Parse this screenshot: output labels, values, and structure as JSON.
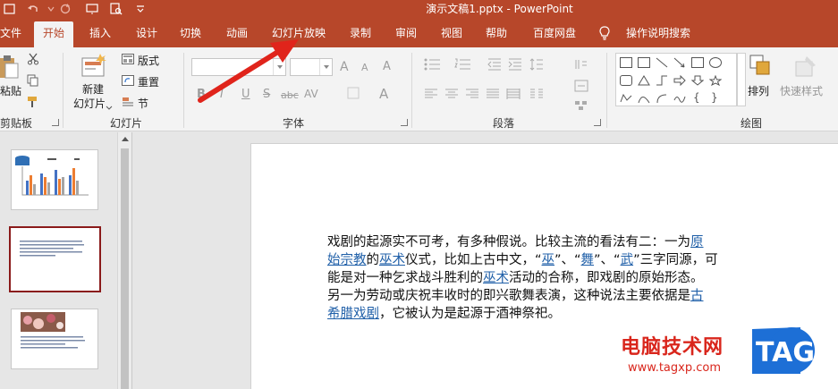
{
  "window": {
    "title": "演示文稿1.pptx  -  PowerPoint"
  },
  "tabs": [
    "文件",
    "开始",
    "插入",
    "设计",
    "切换",
    "动画",
    "幻灯片放映",
    "录制",
    "审阅",
    "视图",
    "帮助",
    "百度网盘"
  ],
  "active_tab": "开始",
  "tell_me": "操作说明搜索",
  "ribbon": {
    "clipboard": {
      "paste": "粘贴",
      "label": "剪贴板"
    },
    "slides": {
      "new_slide_1": "新建",
      "new_slide_2": "幻灯片",
      "layout": "版式",
      "reset": "重置",
      "section": "节",
      "label": "幻灯片"
    },
    "font": {
      "label": "字体",
      "bold": "B",
      "italic": "I",
      "underline": "U",
      "strike": "S",
      "abc": "abc",
      "grow": "A",
      "shrink": "A",
      "clear": "A",
      "color": "A",
      "spacing": "AV"
    },
    "paragraph": {
      "label": "段落"
    },
    "drawing": {
      "arrange": "排列",
      "quick_styles": "快速样式",
      "label": "绘图"
    }
  },
  "slide_text": {
    "lines": [
      [
        {
          "t": "戏剧的起源实不可考，有多种假说。比较主流的看法有二：一为"
        },
        {
          "t": "原",
          "link": true
        }
      ],
      [
        {
          "t": "始宗教",
          "link": true
        },
        {
          "t": "的"
        },
        {
          "t": "巫术",
          "link": true
        },
        {
          "t": "仪式，比如上古中文，“"
        },
        {
          "t": "巫",
          "link": true
        },
        {
          "t": "”、“"
        },
        {
          "t": "舞",
          "link": true
        },
        {
          "t": "”、“"
        },
        {
          "t": "武",
          "link": true
        },
        {
          "t": "”三字同源，可"
        }
      ],
      [
        {
          "t": "能是对一种乞求战斗胜利的"
        },
        {
          "t": "巫术",
          "link": true
        },
        {
          "t": "活动的合称，即戏剧的原始形态。"
        }
      ],
      [
        {
          "t": "另一为劳动或庆祝丰收时的即兴歌舞表演，这种说法主要依据是"
        },
        {
          "t": "古",
          "link": true
        }
      ],
      [
        {
          "t": "希腊戏剧",
          "link": true
        },
        {
          "t": "，它被认为是起源于酒神祭祀。"
        }
      ]
    ]
  },
  "watermark": {
    "text": "电脑技术网",
    "url": "www.tagxp.com",
    "tag": "TAG"
  },
  "colors": {
    "brand": "#b7472a",
    "selected_thumb": "#8a1a1a",
    "link": "#1f5fa8",
    "arrow": "#e0241b"
  }
}
